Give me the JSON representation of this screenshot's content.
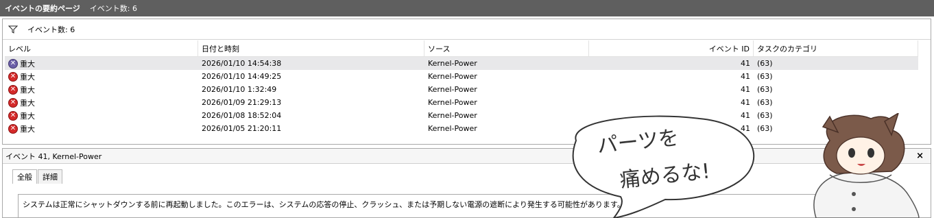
{
  "window": {
    "title": "イベントの要約ページ",
    "title_count": "イベント数: 6"
  },
  "filter": {
    "label": "イベント数: 6"
  },
  "columns": {
    "level": "レベル",
    "date": "日付と時刻",
    "source": "ソース",
    "event_id": "イベント ID",
    "category": "タスクのカテゴリ"
  },
  "rows": [
    {
      "level": "重大",
      "date": "2026/01/10 14:54:38",
      "source": "Kernel-Power",
      "event_id": "41",
      "category": "(63)"
    },
    {
      "level": "重大",
      "date": "2026/01/10 14:49:25",
      "source": "Kernel-Power",
      "event_id": "41",
      "category": "(63)"
    },
    {
      "level": "重大",
      "date": "2026/01/10 1:32:49",
      "source": "Kernel-Power",
      "event_id": "41",
      "category": "(63)"
    },
    {
      "level": "重大",
      "date": "2026/01/09 21:29:13",
      "source": "Kernel-Power",
      "event_id": "41",
      "category": "(63)"
    },
    {
      "level": "重大",
      "date": "2026/01/08 18:52:04",
      "source": "Kernel-Power",
      "event_id": "41",
      "category": "(63)"
    },
    {
      "level": "重大",
      "date": "2026/01/05 21:20:11",
      "source": "Kernel-Power",
      "event_id": "41",
      "category": "(63)"
    }
  ],
  "detail": {
    "title": "イベント 41, Kernel-Power",
    "close": "×",
    "tabs": [
      "全般",
      "詳細"
    ],
    "description": "システムは正常にシャットダウンする前に再起動しました。このエラーは、システムの応答の停止、クラッシュ、または予期しない電源の遮断により発生する可能性があります。"
  },
  "speech_bubble": {
    "line1": "パーツを",
    "line2": "痛めるな!"
  },
  "colors": {
    "titlebar": "#5f5f5f",
    "selected_row": "#e8e8ea",
    "error_red": "#d42a2a",
    "error_selected": "#6b5fa8"
  }
}
